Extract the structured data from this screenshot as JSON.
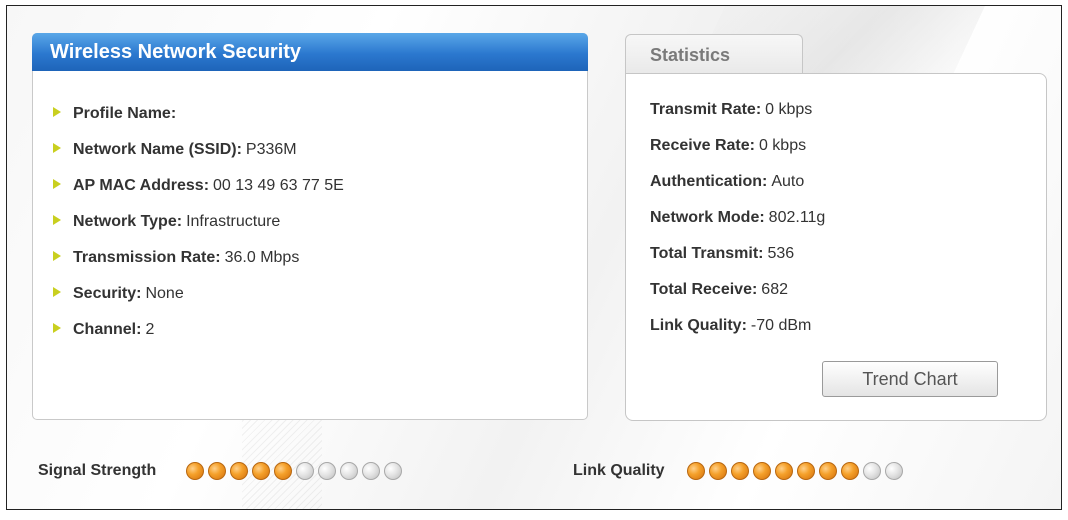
{
  "security_panel": {
    "title": "Wireless Network Security",
    "items": [
      {
        "label": "Profile Name:",
        "value": ""
      },
      {
        "label": "Network Name (SSID):",
        "value": "P336M"
      },
      {
        "label": "AP MAC Address:",
        "value": "00 13 49 63 77 5E"
      },
      {
        "label": "Network Type:",
        "value": "Infrastructure"
      },
      {
        "label": "Transmission Rate:",
        "value": "36.0 Mbps"
      },
      {
        "label": "Security:",
        "value": "None"
      },
      {
        "label": "Channel:",
        "value": "2"
      }
    ]
  },
  "statistics": {
    "tab_label": "Statistics",
    "items": [
      {
        "label": "Transmit Rate:",
        "value": "0 kbps"
      },
      {
        "label": "Receive Rate:",
        "value": "0 kbps"
      },
      {
        "label": "Authentication:",
        "value": "Auto"
      },
      {
        "label": "Network Mode:",
        "value": "802.11g"
      },
      {
        "label": "Total Transmit:",
        "value": "536"
      },
      {
        "label": "Total Receive:",
        "value": "682"
      },
      {
        "label": "Link Quality:",
        "value": "-70 dBm"
      }
    ],
    "trend_button_label": "Trend Chart"
  },
  "indicators": {
    "signal_strength": {
      "label": "Signal Strength",
      "level": 5,
      "max": 10
    },
    "link_quality": {
      "label": "Link Quality",
      "level": 8,
      "max": 10
    }
  },
  "colors": {
    "header_blue": "#2b78cf",
    "dot_on": "#f5a12b",
    "dot_off": "#d6d6d6",
    "bullet": "#c9cf1f"
  }
}
